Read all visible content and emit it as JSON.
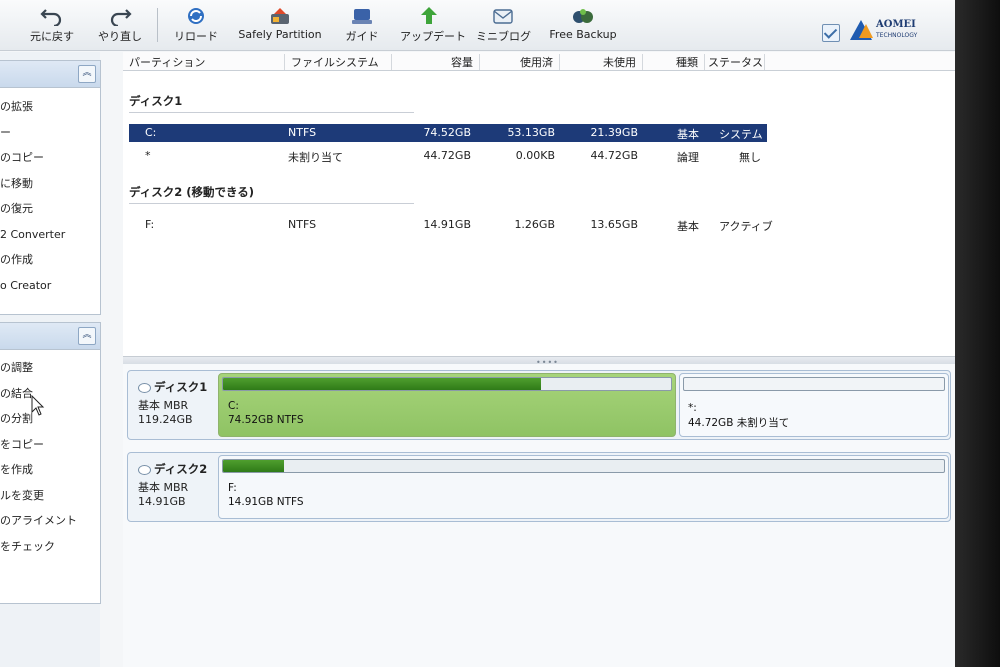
{
  "toolbar": {
    "undo": "元に戻す",
    "redo": "やり直し",
    "reload": "リロード",
    "safely_partition": "Safely Partition",
    "guide": "ガイド",
    "update": "アップデート",
    "miniblog": "ミニブログ",
    "free_backup": "Free Backup",
    "logo_brand": "AOMEI",
    "logo_sub": "TECHNOLOGY"
  },
  "left_panel_1": {
    "items": [
      "の拡張",
      "ー",
      "のコピー",
      "に移動",
      "の復元",
      "2 Converter",
      "の作成",
      "o Creator"
    ]
  },
  "left_panel_2": {
    "items": [
      "の調整",
      "の結合",
      "の分割",
      "をコピー",
      "を作成",
      "ルを変更",
      "のアライメント",
      "をチェック"
    ]
  },
  "columns": {
    "partition": "パーティション",
    "filesystem": "ファイルシステム",
    "capacity": "容量",
    "used": "使用済",
    "unused": "未使用",
    "type": "種類",
    "status": "ステータス"
  },
  "disk1_group": "ディスク1",
  "disk2_group": "ディスク2 (移動できる)",
  "rows": [
    {
      "partition": "C:",
      "fs": "NTFS",
      "capacity": "74.52GB",
      "used": "53.13GB",
      "unused": "21.39GB",
      "type": "基本",
      "status": "システム"
    },
    {
      "partition": "*",
      "fs": "未割り当て",
      "capacity": "44.72GB",
      "used": "0.00KB",
      "unused": "44.72GB",
      "type": "論理",
      "status": "無し"
    },
    {
      "partition": "F:",
      "fs": "NTFS",
      "capacity": "14.91GB",
      "used": "1.26GB",
      "unused": "13.65GB",
      "type": "基本",
      "status": "アクティブ"
    }
  ],
  "disk_map": [
    {
      "name": "ディスク1",
      "kind": "基本 MBR",
      "size": "119.24GB",
      "partitions": [
        {
          "label": "C:",
          "detail": "74.52GB NTFS",
          "used_fraction": 0.71
        },
        {
          "label": "*:",
          "detail": "44.72GB 未割り当て",
          "used_fraction": 0
        }
      ]
    },
    {
      "name": "ディスク2",
      "kind": "基本 MBR",
      "size": "14.91GB",
      "partitions": [
        {
          "label": "F:",
          "detail": "14.91GB NTFS",
          "used_fraction": 0.085
        }
      ]
    }
  ],
  "colors": {
    "selection": "#1d3a78",
    "used_bar": "#3f8c22",
    "selected_partition": "#9cce6f"
  }
}
